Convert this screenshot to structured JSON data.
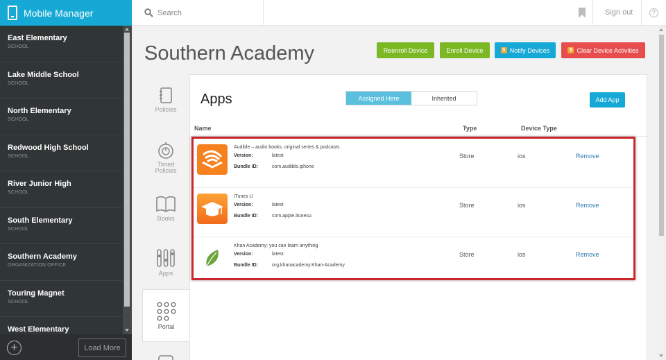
{
  "brand": {
    "title": "Mobile Manager"
  },
  "sidebar": {
    "schools": [
      {
        "name": "East Elementary",
        "type": "SCHOOL"
      },
      {
        "name": "Lake Middle School",
        "type": "SCHOOL"
      },
      {
        "name": "North Elementary",
        "type": "SCHOOL"
      },
      {
        "name": "Redwood High School",
        "type": "SCHOOL"
      },
      {
        "name": "River Junior High",
        "type": "SCHOOL"
      },
      {
        "name": "South Elementary",
        "type": "SCHOOL"
      },
      {
        "name": "Southern Academy",
        "type": "ORGANIZATION OFFICE"
      },
      {
        "name": "Touring Magnet",
        "type": "SCHOOL"
      },
      {
        "name": "West Elementary",
        "type": ""
      }
    ],
    "add_icon": "plus-circle-icon",
    "load_more_label": "Load More"
  },
  "topbar": {
    "search_placeholder": "Search",
    "bookmark_icon": "bookmark-icon",
    "sign_out_label": "Sign out",
    "help_icon": "help-circle-icon",
    "help_glyph": "?"
  },
  "page": {
    "title": "Southern Academy",
    "actions": {
      "reenroll_label": "Reenroll Device",
      "enroll_label": "Enroll Device",
      "notify_label": "Notify Devices",
      "clear_label": "Clear Device Activities",
      "badge_glyph": "$"
    },
    "colors": {
      "primary": "#16a9d6",
      "success": "#7bb824",
      "danger": "#e84d4d",
      "badge": "#f0a637",
      "highlight_border": "#c9292d"
    }
  },
  "tabs": [
    {
      "label": "Policies",
      "icon": "notebook-icon"
    },
    {
      "label": "Timed Policies",
      "icon": "stopwatch-icon"
    },
    {
      "label": "Books",
      "icon": "open-book-icon"
    },
    {
      "label": "Apps",
      "icon": "app-tools-icon"
    },
    {
      "label": "Portal",
      "icon": "grid-dots-icon",
      "active": true
    },
    {
      "label": "",
      "icon": "device-icon"
    }
  ],
  "apps_panel": {
    "title": "Apps",
    "toggle": {
      "assigned_label": "Assigned Here",
      "inherited_label": "Inherited",
      "selected": "Assigned Here"
    },
    "add_app_label": "Add App",
    "columns": {
      "name": "Name",
      "type": "Type",
      "device_type": "Device Type"
    },
    "version_label": "Version:",
    "bundle_label": "Bundle ID:",
    "rows": [
      {
        "name": "Audible – audio books, original series & podcasts",
        "version": "latest",
        "bundle_id": "com.audible.iphone",
        "type": "Store",
        "device_type": "ios",
        "action": "Remove",
        "icon": "audible-app-icon"
      },
      {
        "name": "iTunes U",
        "version": "latest",
        "bundle_id": "com.apple.itunesu",
        "type": "Store",
        "device_type": "ios",
        "action": "Remove",
        "icon": "itunes-u-app-icon"
      },
      {
        "name": "Khan Academy: you can learn anything",
        "version": "latest",
        "bundle_id": "org.khanacademy.Khan-Academy",
        "type": "Store",
        "device_type": "ios",
        "action": "Remove",
        "icon": "khan-academy-app-icon"
      }
    ]
  }
}
